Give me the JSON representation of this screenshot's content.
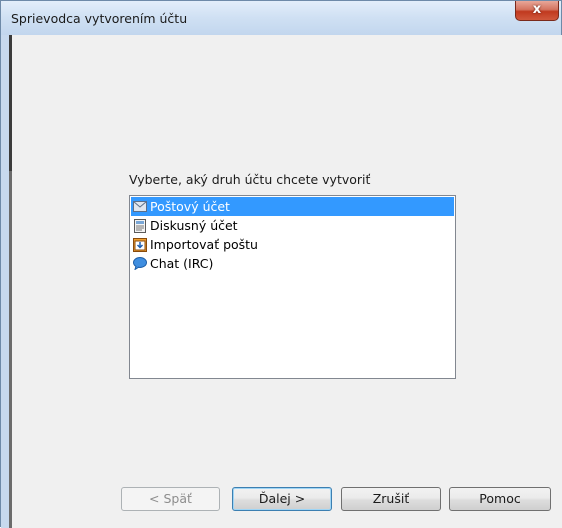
{
  "window": {
    "title": "Sprievodca vytvorením účtu",
    "close_label": "x"
  },
  "main": {
    "prompt": "Vyberte, aký druh účtu chcete vytvoriť",
    "items": [
      {
        "label": "Poštový účet",
        "icon": "mail-envelope-icon",
        "selected": true
      },
      {
        "label": "Diskusný účet",
        "icon": "newsgroup-icon",
        "selected": false
      },
      {
        "label": "Importovať poštu",
        "icon": "import-mail-icon",
        "selected": false
      },
      {
        "label": "Chat (IRC)",
        "icon": "chat-bubble-icon",
        "selected": false
      }
    ]
  },
  "buttons": {
    "back": "< Späť",
    "next": "Ďalej >",
    "cancel": "Zrušiť",
    "help": "Pomoc"
  },
  "colors": {
    "selection": "#3399ff",
    "titlebar": "#cfe0f3",
    "close": "#c0391f"
  }
}
